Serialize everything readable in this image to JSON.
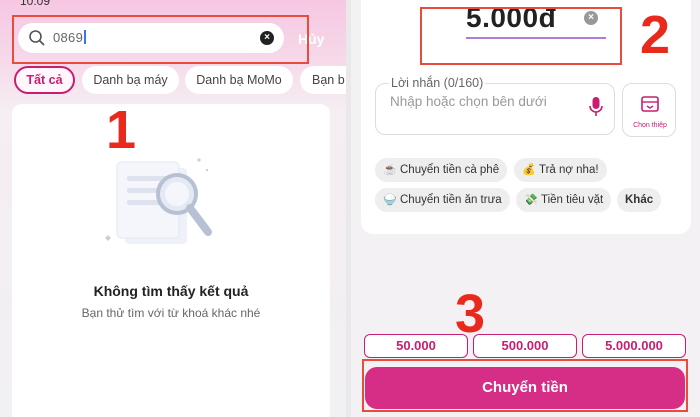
{
  "left": {
    "status_time": "10:09",
    "search": {
      "value": "0869",
      "cancel_label": "Hủy"
    },
    "chips": [
      "Tất cả",
      "Danh bạ máy",
      "Danh bạ MoMo",
      "Bạn b"
    ],
    "empty": {
      "title": "Không tìm thấy kết quả",
      "subtitle": "Bạn thử tìm với từ khoá khác nhé"
    },
    "step_label": "1"
  },
  "right": {
    "amount": "5.000đ",
    "message": {
      "label": "Lời nhắn (0/160)",
      "placeholder": "Nhập hoặc chọn bên dưới"
    },
    "card_button_label": "Chọn thiệp",
    "quick_messages": [
      "Chuyển tiền cà phê",
      "Trả nợ nha!",
      "Chuyển tiền ăn trưa",
      "Tiền tiêu vặt"
    ],
    "more_label": "Khác",
    "presets": [
      "50.000",
      "500.000",
      "5.000.000"
    ],
    "submit_label": "Chuyển tiền",
    "step_amount_label": "2",
    "step_submit_label": "3"
  },
  "colors": {
    "accent": "#c81e71",
    "button": "#d62d87",
    "annotation": "#e74c3c"
  },
  "icons": [
    "search-icon",
    "clear-icon",
    "mic-icon",
    "card-icon",
    "coffee-emoji",
    "money-bag-emoji",
    "rice-emoji",
    "money-wings-emoji"
  ]
}
